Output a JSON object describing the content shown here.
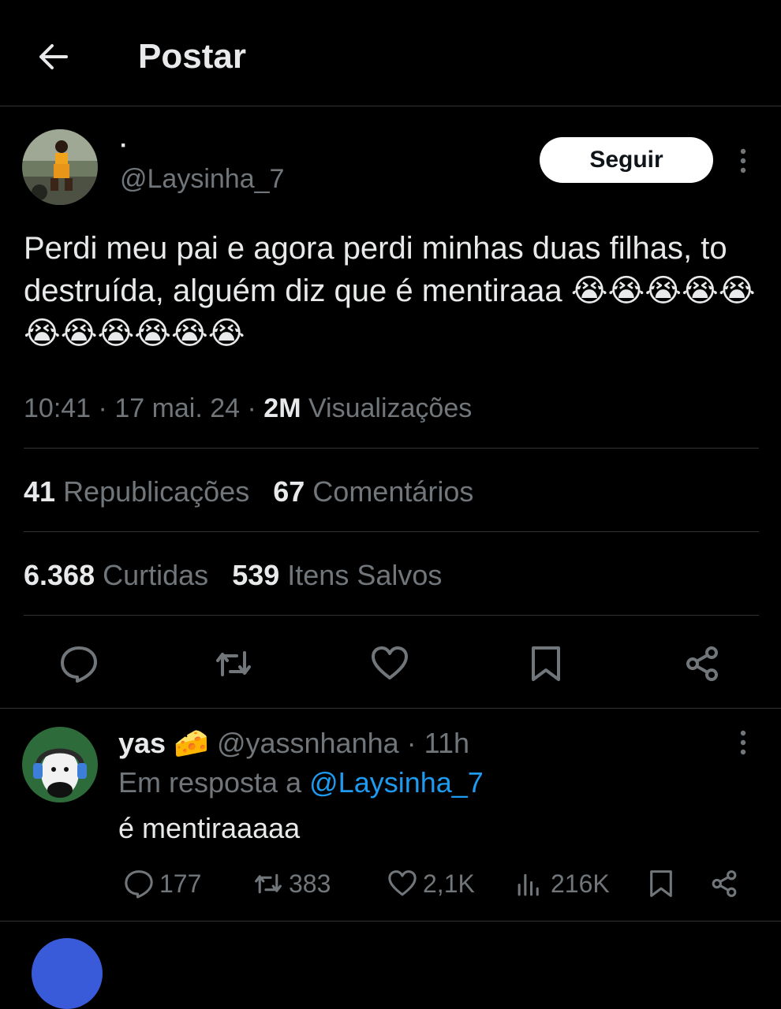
{
  "header": {
    "title": "Postar",
    "back_icon": "arrow-left-icon"
  },
  "tweet": {
    "author_name": "·",
    "author_handle": "@Laysinha_7",
    "follow_label": "Seguir",
    "text": "Perdi meu pai e agora perdi minhas duas filhas, to destruída, alguém diz que é mentiraaa",
    "emoji": "😭😭😭😭😭😭😭😭😭😭😭",
    "time": "10:41",
    "date": "17 mai. 24",
    "views_count": "2M",
    "views_label": "Visualizações",
    "reposts_count": "41",
    "reposts_label": "Republicações",
    "comments_count": "67",
    "comments_label": "Comentários",
    "likes_count": "6.368",
    "likes_label": "Curtidas",
    "saves_count": "539",
    "saves_label": "Itens Salvos"
  },
  "reply": {
    "name": "yas",
    "name_emoji": "🧀",
    "handle": "@yassnhanha",
    "time": "11h",
    "in_reply_prefix": "Em resposta a",
    "in_reply_handle": "@Laysinha_7",
    "text": "é mentiraaaaa",
    "comments": "177",
    "reposts": "383",
    "likes": "2,1K",
    "views": "216K"
  },
  "colors": {
    "background": "#000000",
    "text": "#e7e9ea",
    "muted": "#71767b",
    "link": "#1d9bf0",
    "divider": "#2f3336"
  }
}
